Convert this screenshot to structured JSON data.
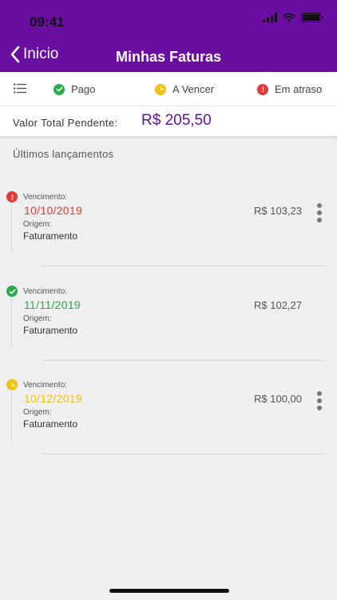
{
  "status_bar": {
    "time": "09:41"
  },
  "header": {
    "back_label": "Inicio",
    "title": "Minhas Faturas"
  },
  "colors": {
    "brand": "#6a0ea1",
    "paid": "#2bab4b",
    "due": "#f2c311",
    "overdue": "#e53935"
  },
  "legend": {
    "menu_icon": "list-icon",
    "items": [
      {
        "label": "Pago",
        "icon": "check-icon",
        "color": "#2bab4b"
      },
      {
        "label": "A Vencer",
        "icon": "clock-icon",
        "color": "#f2c311"
      },
      {
        "label": "Em atraso",
        "icon": "exclamation-icon",
        "color": "#e53935"
      }
    ]
  },
  "total": {
    "label": "Valor Total Pendente:",
    "value": "R$ 205,50"
  },
  "section_title": "Últimos lançamentos",
  "entries": [
    {
      "due_label": "Vencimento:",
      "due_date": "10/10/2019",
      "origin_label": "Origem:",
      "origin": "Faturamento",
      "amount": "R$ 103,23",
      "status": "overdue",
      "date_color": "#e53935"
    },
    {
      "due_label": "Vencimento:",
      "due_date": "11/11/2019",
      "origin_label": "Origem:",
      "origin": "Faturamento",
      "amount": "R$ 102,27",
      "status": "paid",
      "date_color": "#2bab4b"
    },
    {
      "due_label": "Vencimento:",
      "due_date": "10/12/2019",
      "origin_label": "Origem:",
      "origin": "Faturamento",
      "amount": "R$ 100,00",
      "status": "due",
      "date_color": "#f2c311"
    }
  ]
}
